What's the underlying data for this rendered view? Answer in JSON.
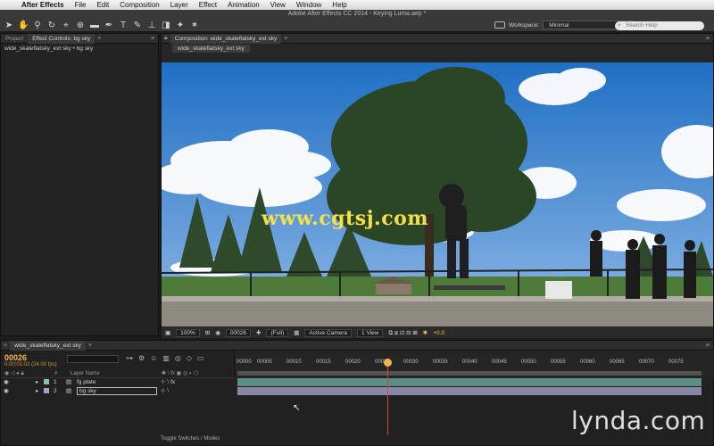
{
  "menubar": {
    "app_name": "After Effects",
    "items": [
      "File",
      "Edit",
      "Composition",
      "Layer",
      "Effect",
      "Animation",
      "View",
      "Window",
      "Help"
    ]
  },
  "window_title": "Adobe After Effects CC 2014 - Keying Luma.aep *",
  "workspace": {
    "label": "Workspace:",
    "value": "Minimal"
  },
  "search": {
    "placeholder": "Search Help"
  },
  "left_panel": {
    "tabs": [
      "Project",
      "Effect Controls: bg sky"
    ],
    "subtitle": "wide_skateflatsky_ext sky • bg sky"
  },
  "comp_panel": {
    "tab": "Composition: wide_skateflatsky_ext sky",
    "subtab": "wide_skateflatsky_ext sky",
    "watermark": "www.cgtsj.com",
    "bottom": {
      "zoom": "100%",
      "timecode": "00026",
      "resolution": "(Full)",
      "camera": "Active Camera",
      "view": "1 View",
      "exposure": "+0.0"
    }
  },
  "timeline": {
    "tab": "wide_skateflatsky_ext sky",
    "timecode": "00026",
    "fps": "0:00:01:02 (24.00 fps)",
    "col_headers": {
      "hash": "#",
      "layer_name": "Layer Name"
    },
    "layers": [
      {
        "num": "1",
        "name": "fg plate",
        "color": "#7fc7b4"
      },
      {
        "num": "2",
        "name": "bg sky",
        "color": "#a9a0c9"
      }
    ],
    "ruler_ticks": [
      "00000",
      "00005",
      "00010",
      "00015",
      "00020",
      "00025",
      "00030",
      "00035",
      "00040",
      "00045",
      "00050",
      "00055",
      "00060",
      "00065",
      "00070",
      "00075"
    ],
    "toggle_label": "Toggle Switches / Modes"
  },
  "branding": "lynda.com",
  "colors": {
    "accent": "#f2b64a",
    "playhead": "#dd4444",
    "track1": "#5b8f86",
    "track2": "#8a86a6"
  }
}
